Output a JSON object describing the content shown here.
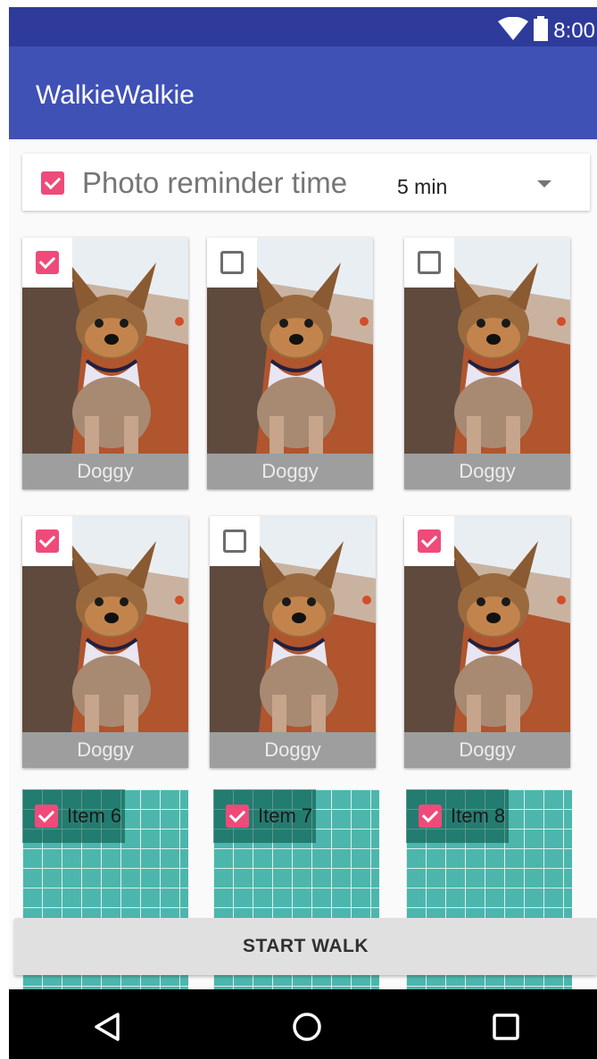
{
  "status_bar": {
    "time": "8:00",
    "icons": [
      "wifi-icon",
      "battery-icon"
    ]
  },
  "app_bar": {
    "title": "WalkieWalkie",
    "color": "#3f51b5"
  },
  "reminder": {
    "checked": true,
    "label": "Photo reminder time",
    "value": "5 min"
  },
  "photo_tiles": [
    {
      "caption": "Doggy",
      "checked": true
    },
    {
      "caption": "Doggy",
      "checked": false
    },
    {
      "caption": "Doggy",
      "checked": false
    },
    {
      "caption": "Doggy",
      "checked": true
    },
    {
      "caption": "Doggy",
      "checked": false
    },
    {
      "caption": "Doggy",
      "checked": true
    }
  ],
  "grid_tiles": [
    {
      "label": "Item 6",
      "checked": true
    },
    {
      "label": "Item 7",
      "checked": true
    },
    {
      "label": "Item 8",
      "checked": true
    }
  ],
  "start_walk_label": "START WALK",
  "nav": {
    "icons": [
      "back-icon",
      "home-icon",
      "recents-icon"
    ]
  },
  "colors": {
    "accent": "#ee4b7a",
    "primary_dark": "#2e3b9a",
    "grid_teal": "#4db6ac"
  }
}
